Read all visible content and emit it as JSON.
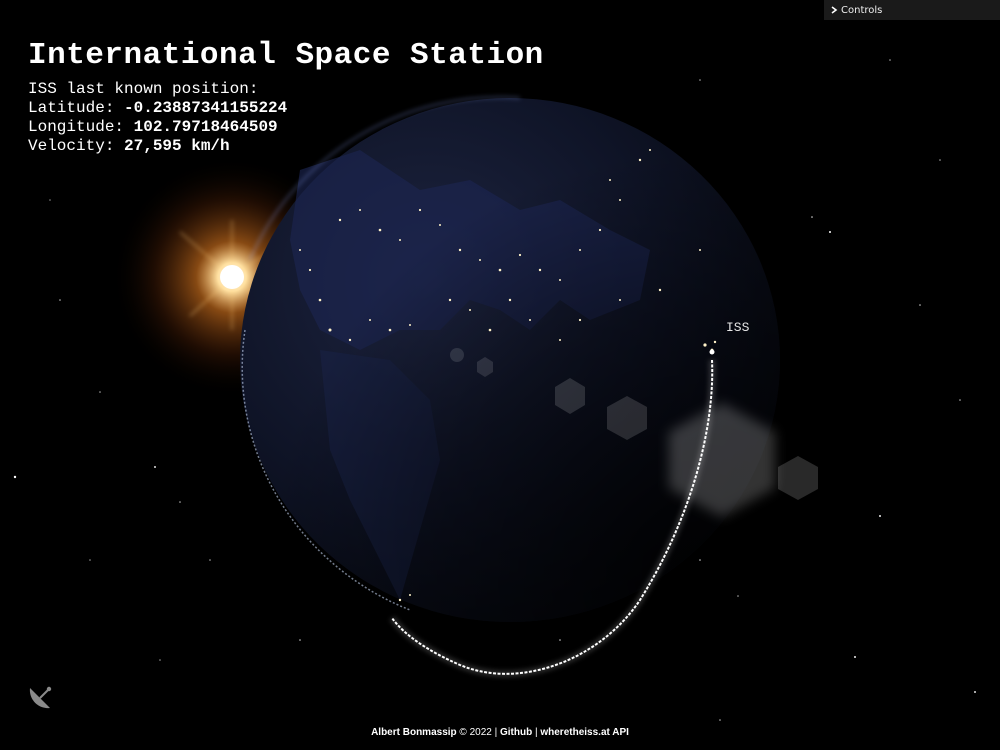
{
  "page": {
    "title": "International Space Station",
    "info": {
      "heading": "ISS last known position:",
      "latitude_label": "Latitude: ",
      "latitude_value": "-0.23887341155224",
      "longitude_label": "Longitude: ",
      "longitude_value": "102.79718464509",
      "velocity_label": "Velocity: ",
      "velocity_value": "27,595 km/h"
    }
  },
  "controls": {
    "label": "Controls",
    "icon": "chevron-right-icon"
  },
  "scene": {
    "iss_marker_label": "ISS"
  },
  "footer": {
    "author": "Albert Bonmassip",
    "copyright": " © 2022 | ",
    "github_link": "Github",
    "separator": " | ",
    "api_link": "wheretheiss.at API"
  },
  "icons": {
    "dish": "satellite-dish-icon"
  }
}
